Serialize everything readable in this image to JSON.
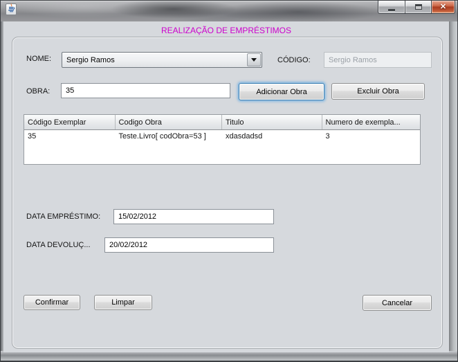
{
  "window": {
    "controls": {
      "minimize": "minimize",
      "maximize": "maximize",
      "close": "r"
    },
    "icon": "java-coffee-cup"
  },
  "colors": {
    "title_accent": "#cc00cc",
    "close_button": "#b5441f",
    "client_background": "#d6d9dd",
    "focus_ring": "#6eafe3"
  },
  "header": {
    "title": "REALIZAÇÃO DE EMPRÉSTIMOS"
  },
  "form": {
    "nome": {
      "label": "NOME:",
      "value": "Sergio Ramos"
    },
    "codigo": {
      "label": "CÓDIGO:",
      "value": "Sergio Ramos"
    },
    "obra": {
      "label": "OBRA:",
      "value": "35"
    },
    "adicionar_obra_label": "Adicionar Obra",
    "excluir_obra_label": "Excluir Obra",
    "data_emprestimo": {
      "label": "DATA EMPRÉSTIMO:",
      "value": "15/02/2012"
    },
    "data_devolucao": {
      "label": "DATA DEVOLUÇ...",
      "value": "20/02/2012"
    },
    "confirmar_label": "Confirmar",
    "limpar_label": "Limpar",
    "cancelar_label": "Cancelar"
  },
  "table": {
    "columns": [
      "Código Exemplar",
      "Codigo Obra",
      "Titulo",
      "Numero de exempla..."
    ],
    "rows": [
      [
        "35",
        "Teste.Livro[ codObra=53 ]",
        "xdasdadsd",
        "3"
      ]
    ]
  }
}
